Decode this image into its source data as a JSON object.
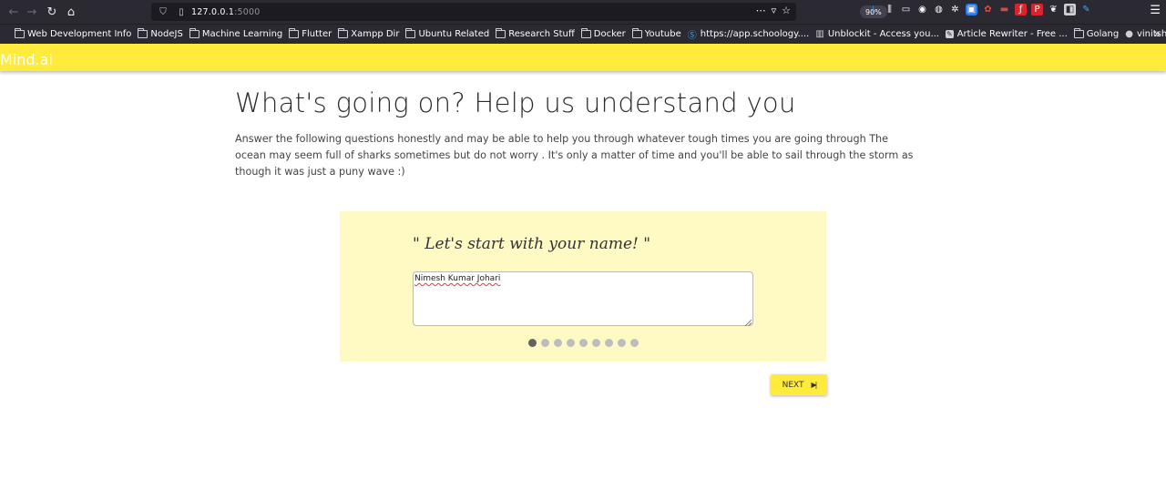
{
  "browser": {
    "url_host": "127.0.0.1",
    "url_port": ":5000",
    "zoom": "90%",
    "bookmarks": [
      {
        "label": "Web Development Info",
        "icon": "folder"
      },
      {
        "label": "NodeJS",
        "icon": "folder"
      },
      {
        "label": "Machine Learning",
        "icon": "folder"
      },
      {
        "label": "Flutter",
        "icon": "folder"
      },
      {
        "label": "Xampp Dir",
        "icon": "folder"
      },
      {
        "label": "Ubuntu Related",
        "icon": "folder"
      },
      {
        "label": "Research Stuff",
        "icon": "folder"
      },
      {
        "label": "Docker",
        "icon": "folder"
      },
      {
        "label": "Youtube",
        "icon": "folder"
      },
      {
        "label": "https://app.schoology....",
        "icon": "schoology"
      },
      {
        "label": "Unblockit - Access you...",
        "icon": "unblockit"
      },
      {
        "label": "Article Rewriter - Free ...",
        "icon": "rewriter"
      },
      {
        "label": "Golang",
        "icon": "folder"
      },
      {
        "label": "vinitshahdeo/Hacktobe...",
        "icon": "github"
      }
    ]
  },
  "app": {
    "brand": "Mind.ai",
    "accent_color": "#ffeb3b",
    "card_color": "#fff9c4"
  },
  "page": {
    "title": "What's going on? Help us understand you",
    "intro": "Answer the following questions honestly and may be able to help you through whatever tough times you are going through The ocean may seem full of sharks sometimes but do not worry . It's only a matter of time and you'll be able to sail through the storm as though it was just a puny wave :)"
  },
  "form": {
    "question": "\" Let's start with your name! \"",
    "answer": "Nimesh Kumar Johari",
    "step_current": 1,
    "step_total": 9,
    "next_label": "NEXT"
  }
}
